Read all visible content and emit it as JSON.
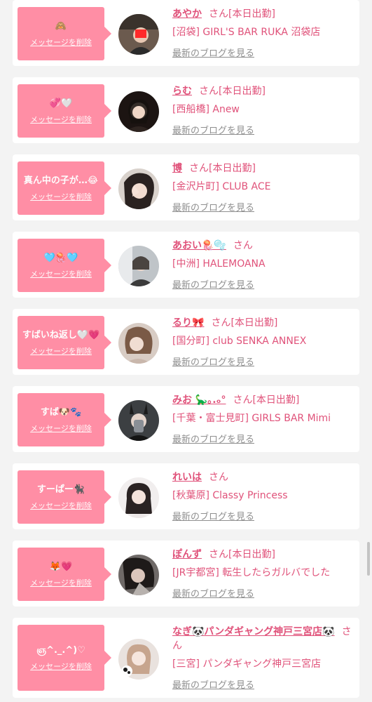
{
  "theme": {
    "bubble_color": "#ff8ea5",
    "name_color": "#e0527a",
    "link_color": "#8f8f8f",
    "background": "#f3f3f3"
  },
  "items": [
    {
      "message": "🙈",
      "delete_label": "メッセージを削除",
      "name": "あやか",
      "san": "さん",
      "status": "[本日出勤]",
      "shop": "[沼袋] GIRL'S BAR RUKA 沼袋店",
      "blog_label": "最新のブログを見る",
      "avatar": "avatar-photo"
    },
    {
      "message": "💞🤍",
      "delete_label": "メッセージを削除",
      "name": "らむ",
      "san": "さん",
      "status": "[本日出勤]",
      "shop": "[西船橋] Anew",
      "blog_label": "最新のブログを見る",
      "avatar": "avatar-photo"
    },
    {
      "message": "真ん中の子が…😂",
      "delete_label": "メッセージを削除",
      "name": "博",
      "san": "さん",
      "status": "[本日出勤]",
      "shop": "[金沢片町] CLUB ACE",
      "blog_label": "最新のブログを見る",
      "avatar": "avatar-photo"
    },
    {
      "message": "🩵🪼🩵",
      "delete_label": "メッセージを削除",
      "name": "あおい🪼🫧",
      "san": "さん",
      "status": "",
      "shop": "[中洲] HALEMOANA",
      "blog_label": "最新のブログを見る",
      "avatar": "avatar-photo"
    },
    {
      "message": "すばいね返し🤍💗",
      "delete_label": "メッセージを削除",
      "name": "るり🎀",
      "san": "さん",
      "status": "[本日出勤]",
      "shop": "[国分町] club SENKA ANNEX",
      "blog_label": "最新のブログを見る",
      "avatar": "avatar-photo"
    },
    {
      "message": "すば🐶🐾",
      "delete_label": "メッセージを削除",
      "name": "みお 🦕｡.ₒ°",
      "san": "さん",
      "status": "[本日出勤]",
      "shop": "[千葉・富士見町] GIRLS BAR Mimi",
      "blog_label": "最新のブログを見る",
      "avatar": "avatar-photo"
    },
    {
      "message": "すーぱー🐈‍⬛",
      "delete_label": "メッセージを削除",
      "name": "れいは",
      "san": "さん",
      "status": "",
      "shop": "[秋葉原] Classy Princess",
      "blog_label": "最新のブログを見る",
      "avatar": "avatar-photo"
    },
    {
      "message": "🦊💗",
      "delete_label": "メッセージを削除",
      "name": "ぽんず",
      "san": "さん",
      "status": "[本日出勤]",
      "shop": "[JR宇都宮] 転生したらガルバでした",
      "blog_label": "最新のブログを見る",
      "avatar": "avatar-photo"
    },
    {
      "message": "ஞ^._.^)♡",
      "delete_label": "メッセージを削除",
      "name": "なぎ🐼パンダギャング神戸三宮店🐼",
      "san": "さん",
      "status": "",
      "shop": "[三宮] パンダギャング神戸三宮店",
      "blog_label": "最新のブログを見る",
      "avatar": "avatar-photo"
    }
  ]
}
